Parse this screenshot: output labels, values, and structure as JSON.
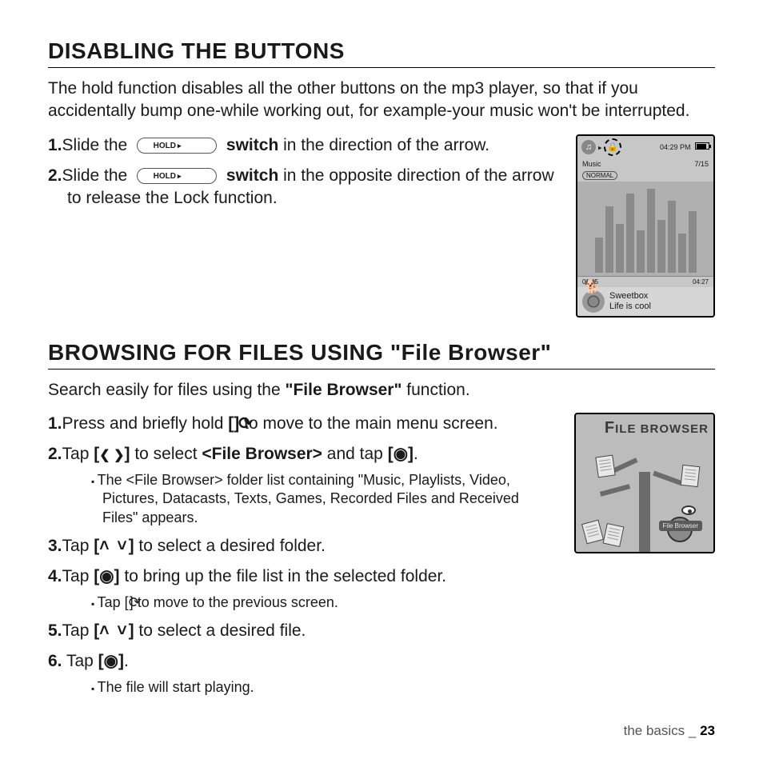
{
  "section1": {
    "heading": "DISABLING THE BUTTONS",
    "intro": "The hold function disables all the other buttons on the mp3 player, so that if you accidentally bump one-while working out, for example-your music won't be interrupted.",
    "steps": [
      {
        "num": "1.",
        "a": "Slide the ",
        "switch": "HOLD",
        "b": " switch",
        "c": " in the direction of the arrow."
      },
      {
        "num": "2.",
        "a": "Slide the ",
        "switch": "HOLD",
        "b": " switch",
        "c": " in the opposite direction of the arrow to release the Lock function."
      }
    ]
  },
  "player": {
    "music_label": "Music",
    "time": "04:29 PM",
    "track_index": "7/15",
    "mode": "NORMAL",
    "elapsed": "01:45",
    "total": "04:27",
    "track_artist": "Sweetbox",
    "track_title": "Life is cool"
  },
  "section2": {
    "heading": "BROWSING FOR FILES USING \"File Browser\"",
    "intro_a": "Search easily for files using the ",
    "intro_b": "\"File Browser\"",
    "intro_c": " function.",
    "steps": {
      "s1": {
        "num": "1.",
        "a": "Press and briefly hold ",
        "b": " to move to the main menu screen."
      },
      "s2": {
        "num": "2.",
        "a": "Tap ",
        "b": " to select ",
        "c": "<File Browser>",
        "d": " and tap ",
        "e": ".",
        "sub": "The <File Browser> folder list containing \"Music, Playlists, Video, Pictures, Datacasts, Texts, Games, Recorded Files and Received Files\" appears."
      },
      "s3": {
        "num": "3.",
        "a": "Tap ",
        "b": " to select a desired folder."
      },
      "s4": {
        "num": "4.",
        "a": "Tap ",
        "b": " to bring up the file list in the selected folder.",
        "sub": " to move to the previous screen.",
        "sub_pre": "Tap [",
        "sub_post": "]"
      },
      "s5": {
        "num": "5.",
        "a": "Tap ",
        "b": " to select a desired file."
      },
      "s6": {
        "num": "6.",
        "a": " Tap ",
        "b": ".",
        "sub": "The file will start playing."
      }
    }
  },
  "fb": {
    "title_pre": "F",
    "title_big": "ILE",
    "title_rest": "BROWSER",
    "label": "File Browser"
  },
  "footer": {
    "section": "the basics",
    "sep": " _ ",
    "page": "23"
  }
}
